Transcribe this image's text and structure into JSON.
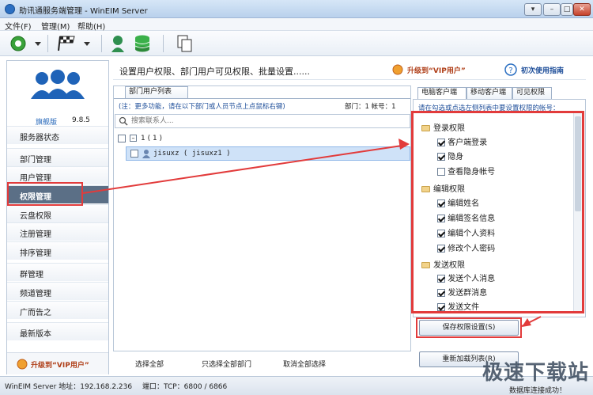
{
  "window": {
    "title": "助讯通服务端管理 - WinEIM Server"
  },
  "menu": {
    "items": [
      "文件(F)",
      "管理(M)",
      "帮助(H)"
    ]
  },
  "sidebar": {
    "edition": "旗舰版",
    "version": "9.8.5",
    "items": [
      "服务器状态",
      "部门管理",
      "用户管理",
      "权限管理",
      "云盘权限",
      "注册管理",
      "排序管理",
      "群管理",
      "频道管理",
      "广而告之",
      "最新版本"
    ],
    "upgrade": "升级到“VIP用户”"
  },
  "header": {
    "title": "设置用户权限、部门用户可见权限、批量设置......",
    "upgrade": "升级到“VIP用户”",
    "help": "初次使用指南"
  },
  "left": {
    "tab": "部门用户列表",
    "note": "(注：更多功能，请在以下部门或人员节点上点鼠标右键)",
    "counts": "部门：1  帐号：1",
    "search_placeholder": "搜索联系人...",
    "tree": {
      "dept": "1 ( 1 )",
      "user": "jisuxz ( jisuxz1 )"
    }
  },
  "right": {
    "tabs": [
      "电脑客户端",
      "移动客户端",
      "可见权限"
    ],
    "hint": "请在勾选或点选左侧列表中要设置权限的帐号：",
    "groups": [
      {
        "name": "登录权限",
        "items": [
          {
            "label": "客户端登录",
            "checked": true
          },
          {
            "label": "隐身",
            "checked": true
          },
          {
            "label": "查看隐身帐号",
            "checked": false
          }
        ]
      },
      {
        "name": "编辑权限",
        "items": [
          {
            "label": "编辑姓名",
            "checked": true
          },
          {
            "label": "编辑签名信息",
            "checked": true
          },
          {
            "label": "编辑个人资料",
            "checked": true
          },
          {
            "label": "修改个人密码",
            "checked": true
          }
        ]
      },
      {
        "name": "发送权限",
        "items": [
          {
            "label": "发送个人消息",
            "checked": true
          },
          {
            "label": "发送群消息",
            "checked": true
          },
          {
            "label": "发送文件",
            "checked": true
          }
        ]
      }
    ],
    "save_button": "保存权限设置(S)",
    "reload_button": "重新加载列表(R)"
  },
  "bottom": {
    "select_all": "选择全部",
    "select_depts": "只选择全部部门",
    "deselect_all": "取消全部选择"
  },
  "status": {
    "server": "WinEIM Server 地址：192.168.2.236",
    "ports": "端口：TCP：6800 / 6866",
    "state": "数据库连接成功！"
  },
  "watermark": "极速下载站",
  "colors": {
    "accent": "#2b6fc2",
    "highlight": "#e23b3b",
    "active_nav": "#5b6f86"
  }
}
